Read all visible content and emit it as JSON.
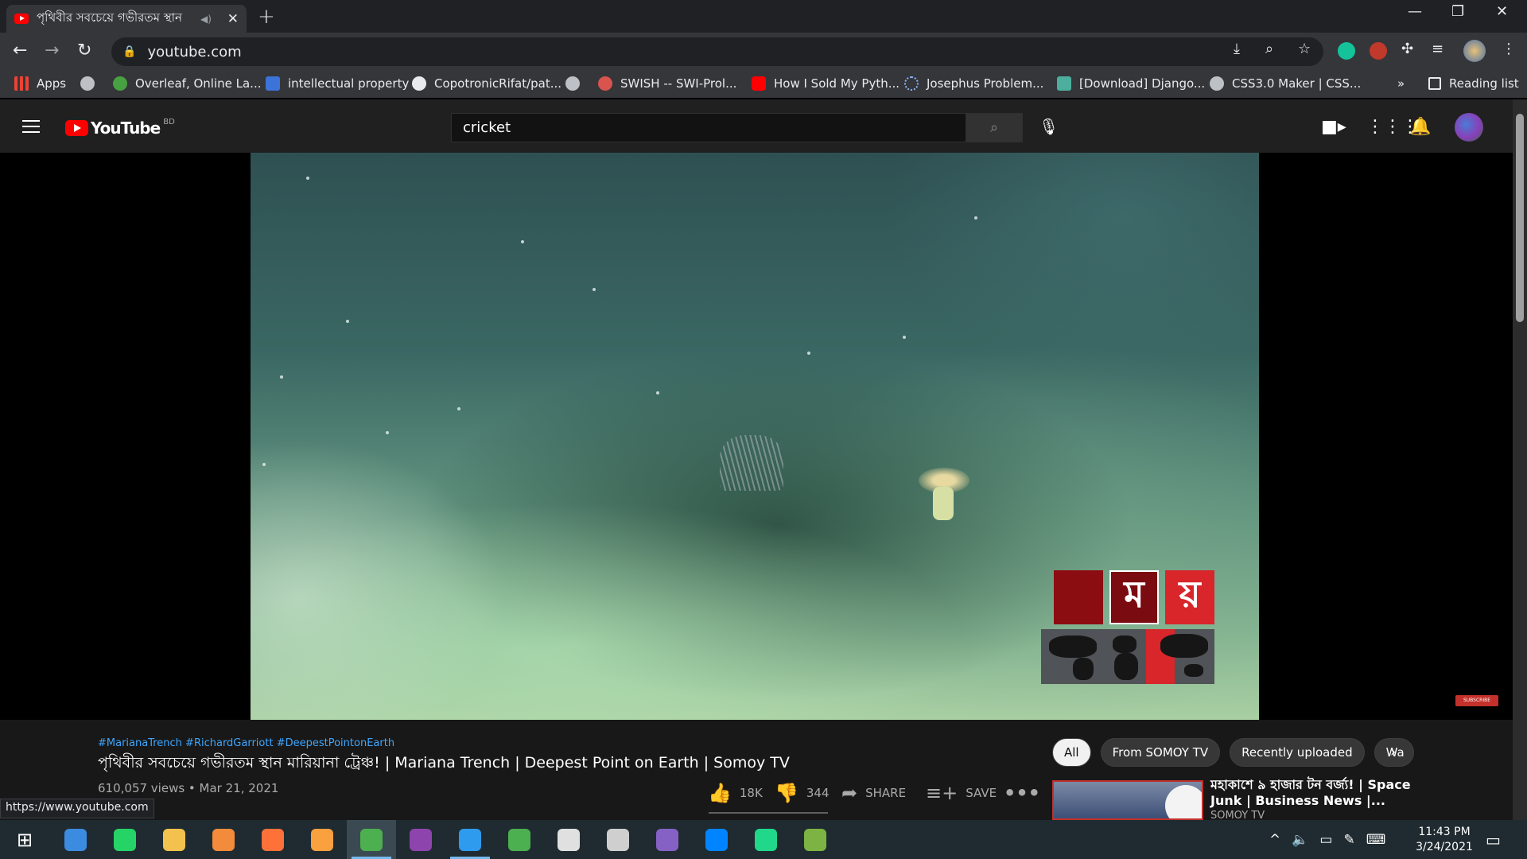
{
  "browser": {
    "tab_title": "পৃথিবীর সবচেয়ে গভীরতম স্থান",
    "url": "youtube.com",
    "bookmarks": [
      "Apps",
      "Overleaf, Online La...",
      "intellectual property",
      "CopotronicRifat/pat...",
      "SWISH -- SWI-Prol...",
      "How I Sold My Pyth...",
      "Josephus Problem...",
      "[Download] Django...",
      "CSS3.0 Maker | CSS..."
    ],
    "reading_list": "Reading list",
    "more": "»",
    "status_url": "https://www.youtube.com"
  },
  "youtube": {
    "logo_text": "YouTube",
    "country_code": "BD",
    "search_value": "cricket",
    "video": {
      "hashtags": "#MarianaTrench #RichardGarriott #DeepestPointonEarth",
      "title": "পৃথিবীর সবচেয়ে গভীরতম স্থান মারিয়ানা ট্রেঞ্চ! | Mariana Trench | Deepest Point on Earth | Somoy TV",
      "views_date": "610,057 views • Mar 21, 2021",
      "likes": "18K",
      "dislikes": "344",
      "share_label": "SHARE",
      "save_label": "SAVE",
      "watermark_letters": [
        "ম",
        "য়"
      ],
      "subscribe_watermark": "SUBSCRIBE"
    },
    "chips": [
      "All",
      "From SOMOY TV",
      "Recently uploaded",
      "Wa"
    ],
    "recommended": {
      "title": "মহাকাশে ৯ হাজার টন বর্জ্য! | Space Junk | Business News |...",
      "channel": "SOMOY TV"
    }
  },
  "taskbar": {
    "time": "11:43 PM",
    "date": "3/24/2021",
    "apps": [
      {
        "name": "start",
        "color": "#ffffff"
      },
      {
        "name": "edge-update",
        "color": "#3b8be0"
      },
      {
        "name": "whatsapp",
        "color": "#25d366"
      },
      {
        "name": "file-explorer",
        "color": "#f2c14e"
      },
      {
        "name": "brave",
        "color": "#f28b3b"
      },
      {
        "name": "firefox",
        "color": "#ff7139"
      },
      {
        "name": "sublime",
        "color": "#f9a03f"
      },
      {
        "name": "chrome",
        "color": "#4caf50"
      },
      {
        "name": "github-desktop",
        "color": "#8e44ad"
      },
      {
        "name": "vscode",
        "color": "#2f9bee"
      },
      {
        "name": "world-app",
        "color": "#4caf50"
      },
      {
        "name": "app-bird",
        "color": "#e0e0e0"
      },
      {
        "name": "app-satellite",
        "color": "#cfcfcf"
      },
      {
        "name": "visual-studio",
        "color": "#8661c5"
      },
      {
        "name": "messenger",
        "color": "#0084ff"
      },
      {
        "name": "pycharm",
        "color": "#21d789"
      },
      {
        "name": "app-notes",
        "color": "#7cb342"
      }
    ]
  }
}
